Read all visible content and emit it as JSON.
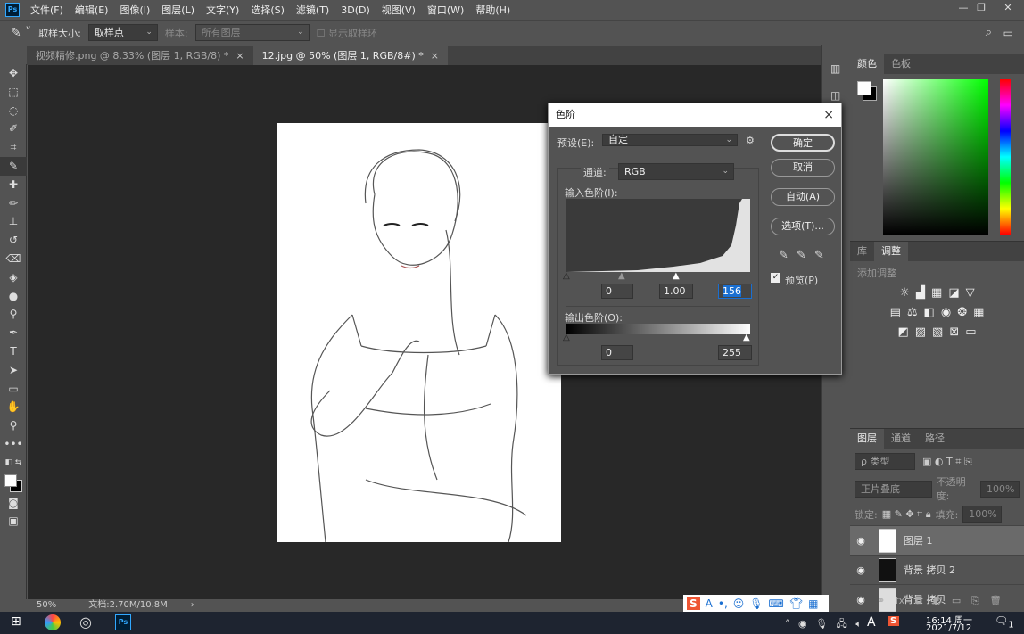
{
  "menu": [
    "文件(F)",
    "编辑(E)",
    "图像(I)",
    "图层(L)",
    "文字(Y)",
    "选择(S)",
    "滤镜(T)",
    "3D(D)",
    "视图(V)",
    "窗口(W)",
    "帮助(H)"
  ],
  "options": {
    "sample_size_label": "取样大小:",
    "sample_size_value": "取样点",
    "sample_label": "样本:",
    "sample_value": "所有图层",
    "show_ring_label": "显示取样环"
  },
  "tabs": [
    {
      "label": "视频精修.png @ 8.33% (图层 1, RGB/8) *"
    },
    {
      "label": "12.jpg @ 50% (图层 1, RGB/8#) *"
    }
  ],
  "tab_close": "×",
  "status": {
    "zoom": "50%",
    "doc": "文档:2.70M/10.8M"
  },
  "dialog": {
    "title": "色阶",
    "close": "×",
    "preset_label": "预设(E):",
    "preset_value": "自定",
    "channel_label": "通道:",
    "channel_value": "RGB",
    "input_label": "输入色阶(I):",
    "input_black": "0",
    "input_gamma": "1.00",
    "input_white": "156",
    "output_label": "输出色阶(O):",
    "output_black": "0",
    "output_white": "255",
    "ok": "确定",
    "cancel": "取消",
    "auto": "自动(A)",
    "options": "选项(T)...",
    "preview_label": "预览(P)",
    "preview_checked": true
  },
  "color_panel": {
    "tabs": [
      "颜色",
      "色板"
    ],
    "active": 0
  },
  "adjust_panel": {
    "tabs": [
      "库",
      "调整"
    ],
    "active": 1,
    "add_label": "添加调整"
  },
  "layers_panel": {
    "tabs": [
      "图层",
      "通道",
      "路径"
    ],
    "active": 0,
    "filter": "ρ 类型",
    "blend": "正片叠底",
    "opacity_label": "不透明度:",
    "opacity": "100%",
    "lock_label": "锁定:",
    "fill_label": "填充:",
    "fill": "100%",
    "layers": [
      {
        "name": "图层 1",
        "selected": true
      },
      {
        "name": "背景 拷贝 2",
        "selected": false
      },
      {
        "name": "背景 拷贝",
        "selected": false
      }
    ]
  },
  "taskbar": {
    "time": "16:14 周一",
    "date": "2021/7/12",
    "ime": "A",
    "notif": "1"
  },
  "colors": {
    "accent": "#31a8ff",
    "highlight": "#1a6fd1"
  }
}
